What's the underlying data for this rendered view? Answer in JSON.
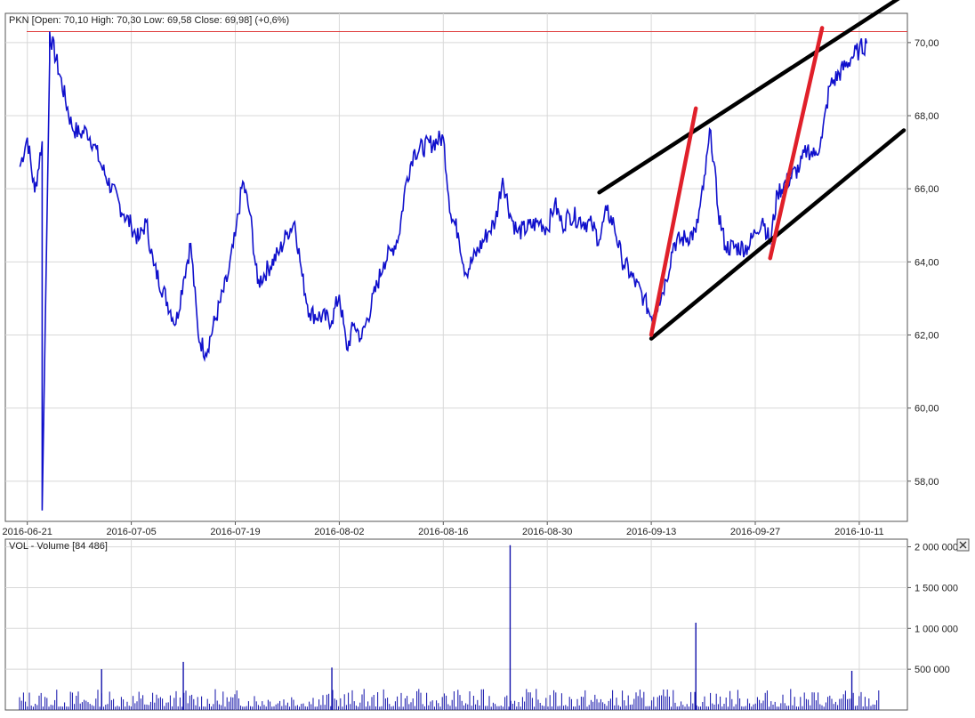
{
  "price_legend": {
    "symbol": "PKN",
    "text": "PKN [Open: 70,10  High: 70,30  Low: 69,58  Close: 69,98] (+0,6%)"
  },
  "volume_legend": {
    "text": "VOL - Volume [84 486]"
  },
  "close_icon": "close-icon",
  "colors": {
    "price_line": "#1010cc",
    "volume_bar": "#1010aa",
    "grid": "#d8d8d8",
    "resistance_line": "#e04040",
    "channel": "#000000",
    "impulse": "#e0202a"
  },
  "chart_data": [
    {
      "type": "line",
      "legend": "PKN [Open: 70,10  High: 70,30  Low: 69,58  Close: 69,98] (+0,6%)",
      "x_ticks": [
        "2016-06-21",
        "2016-07-05",
        "2016-07-19",
        "2016-08-02",
        "2016-08-16",
        "2016-08-30",
        "2016-09-13",
        "2016-09-27",
        "2016-10-11"
      ],
      "y_ticks": [
        "58,00",
        "60,00",
        "62,00",
        "64,00",
        "66,00",
        "68,00",
        "70,00"
      ],
      "ylim": [
        56.9,
        70.8
      ],
      "grid": true,
      "horizontal_line": 70.3,
      "series": [
        {
          "x": [
            "2016-06-20",
            "2016-06-21",
            "2016-06-22",
            "2016-06-23",
            "2016-06-23",
            "2016-06-24",
            "2016-06-24",
            "2016-06-27",
            "2016-06-28",
            "2016-06-29",
            "2016-06-30",
            "2016-07-01",
            "2016-07-04",
            "2016-07-05",
            "2016-07-06",
            "2016-07-07",
            "2016-07-08",
            "2016-07-11",
            "2016-07-12",
            "2016-07-13",
            "2016-07-14",
            "2016-07-15",
            "2016-07-18",
            "2016-07-19",
            "2016-07-20",
            "2016-07-21",
            "2016-07-22",
            "2016-07-25",
            "2016-07-26",
            "2016-07-27",
            "2016-07-28",
            "2016-07-29",
            "2016-08-01",
            "2016-08-02",
            "2016-08-03",
            "2016-08-04",
            "2016-08-05",
            "2016-08-08",
            "2016-08-09",
            "2016-08-10",
            "2016-08-11",
            "2016-08-12",
            "2016-08-16",
            "2016-08-17",
            "2016-08-18",
            "2016-08-19",
            "2016-08-22",
            "2016-08-23",
            "2016-08-24",
            "2016-08-25",
            "2016-08-26",
            "2016-08-29",
            "2016-08-30",
            "2016-08-31",
            "2016-09-01",
            "2016-09-02",
            "2016-09-05",
            "2016-09-06",
            "2016-09-07",
            "2016-09-08",
            "2016-09-09",
            "2016-09-12",
            "2016-09-13",
            "2016-09-14",
            "2016-09-15",
            "2016-09-16",
            "2016-09-19",
            "2016-09-20",
            "2016-09-21",
            "2016-09-22",
            "2016-09-23",
            "2016-09-26",
            "2016-09-27",
            "2016-09-28",
            "2016-09-29",
            "2016-09-30",
            "2016-10-03",
            "2016-10-04",
            "2016-10-05",
            "2016-10-06",
            "2016-10-07",
            "2016-10-10",
            "2016-10-11",
            "2016-10-12"
          ],
          "values": [
            66.6,
            67.4,
            65.9,
            67.3,
            57.2,
            69.5,
            70.3,
            67.7,
            67.5,
            67.6,
            67.2,
            66.6,
            65.3,
            65.0,
            64.6,
            65.1,
            63.9,
            62.3,
            63.5,
            64.5,
            62.0,
            61.5,
            63.6,
            64.7,
            66.2,
            65.3,
            63.4,
            64.3,
            64.8,
            65.1,
            63.6,
            62.6,
            62.4,
            63.1,
            61.6,
            62.3,
            61.9,
            64.0,
            64.3,
            64.7,
            66.2,
            67.0,
            67.4,
            65.3,
            64.8,
            63.7,
            64.8,
            65.1,
            66.3,
            65.3,
            64.8,
            65.1,
            64.9,
            65.6,
            65.0,
            65.3,
            65.0,
            64.6,
            65.4,
            65.0,
            64.1,
            63.0,
            62.5,
            62.9,
            63.5,
            64.5,
            64.8,
            66.0,
            67.6,
            65.4,
            64.4,
            64.4,
            64.8,
            65.2,
            64.5,
            65.9,
            66.6,
            67.1,
            66.9,
            67.4,
            68.8,
            69.6,
            69.8,
            69.98
          ]
        }
      ]
    },
    {
      "type": "bar",
      "legend": "VOL - Volume [84 486]",
      "y_ticks": [
        "500 000",
        "1 000 000",
        "1 500 000",
        "2 000 000"
      ],
      "ylim": [
        0,
        2050000
      ],
      "grid": true,
      "spikes": [
        {
          "x": "2016-08-25",
          "value": 2020000
        },
        {
          "x": "2016-09-19",
          "value": 1070000
        },
        {
          "x": "2016-07-12",
          "value": 590000
        },
        {
          "x": "2016-08-01",
          "value": 520000
        },
        {
          "x": "2016-07-01",
          "value": 500000
        },
        {
          "x": "2016-10-10",
          "value": 480000
        }
      ],
      "typical_range": [
        40000,
        260000
      ]
    }
  ]
}
